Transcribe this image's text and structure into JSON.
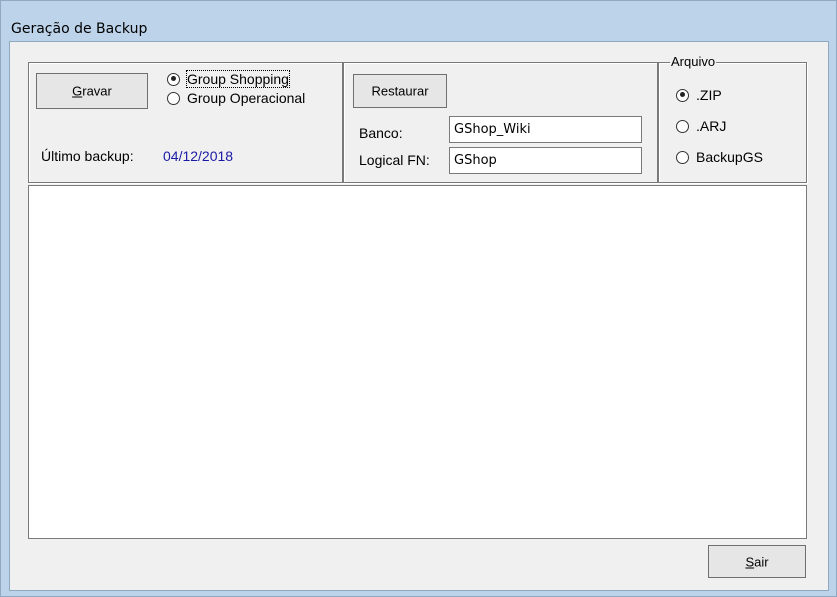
{
  "window": {
    "title": "Geração de Backup"
  },
  "backup": {
    "save_label_accel": "G",
    "save_label_rest": "ravar",
    "target_options": [
      {
        "label": "Group Shopping",
        "checked": true
      },
      {
        "label": "Group Operacional",
        "checked": false
      }
    ],
    "last_backup_label": "Último backup:",
    "last_backup_value": "04/12/2018"
  },
  "restore": {
    "button_label": "Restaurar",
    "banco_label": "Banco:",
    "banco_value": "GShop_Wiki",
    "logical_label": "Logical FN:",
    "logical_value": "GShop"
  },
  "archive": {
    "legend": "Arquivo",
    "options": [
      {
        "label": ".ZIP",
        "checked": true
      },
      {
        "label": ".ARJ",
        "checked": false
      },
      {
        "label": "BackupGS",
        "checked": false
      }
    ]
  },
  "footer": {
    "exit_accel": "S",
    "exit_rest": "air"
  },
  "colors": {
    "title_bar": "#bcd3ea",
    "date_value": "#1a1aa6",
    "form_bg": "#f0f0f0"
  }
}
